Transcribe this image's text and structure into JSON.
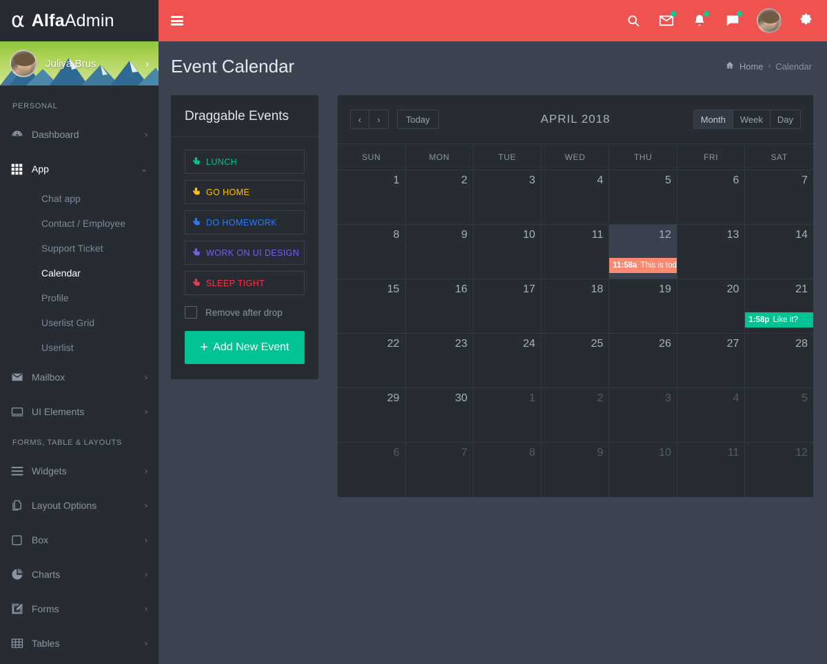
{
  "brand": {
    "glyph": "α",
    "bold": "Alfa",
    "light": "Admin"
  },
  "topbar": {
    "menu_icon": "hamburger-icon",
    "icons": [
      {
        "name": "search-icon",
        "badge": false
      },
      {
        "name": "mail-icon",
        "badge": true
      },
      {
        "name": "bell-icon",
        "badge": true
      },
      {
        "name": "chat-icon",
        "badge": true
      }
    ],
    "avatar_name": "user-avatar",
    "settings_icon": "gear-icon",
    "accent": "#ef5350"
  },
  "sidebar": {
    "profile": {
      "name": "Juliya Brus",
      "chevron": "›"
    },
    "sections": [
      {
        "title": "PERSONAL",
        "items": [
          {
            "label": "Dashboard",
            "icon": "dashboard-icon",
            "arrow": "›",
            "active": false,
            "children": []
          },
          {
            "label": "App",
            "icon": "grid-icon",
            "arrow": "⌄",
            "active": true,
            "children": [
              {
                "label": "Chat app",
                "active": false
              },
              {
                "label": "Contact / Employee",
                "active": false
              },
              {
                "label": "Support Ticket",
                "active": false
              },
              {
                "label": "Calendar",
                "active": true
              },
              {
                "label": "Profile",
                "active": false
              },
              {
                "label": "Userlist Grid",
                "active": false
              },
              {
                "label": "Userlist",
                "active": false
              }
            ]
          },
          {
            "label": "Mailbox",
            "icon": "envelope-icon",
            "arrow": "›",
            "active": false,
            "children": []
          },
          {
            "label": "UI Elements",
            "icon": "monitor-icon",
            "arrow": "›",
            "active": false,
            "children": []
          }
        ]
      },
      {
        "title": "FORMS, TABLE & LAYOUTS",
        "items": [
          {
            "label": "Widgets",
            "icon": "list-icon",
            "arrow": "›",
            "active": false,
            "children": []
          },
          {
            "label": "Layout Options",
            "icon": "copy-icon",
            "arrow": "›",
            "active": false,
            "children": []
          },
          {
            "label": "Box",
            "icon": "square-icon",
            "arrow": "›",
            "active": false,
            "children": []
          },
          {
            "label": "Charts",
            "icon": "pie-chart-icon",
            "arrow": "›",
            "active": false,
            "children": []
          },
          {
            "label": "Forms",
            "icon": "edit-icon",
            "arrow": "›",
            "active": false,
            "children": []
          },
          {
            "label": "Tables",
            "icon": "table-icon",
            "arrow": "›",
            "active": false,
            "children": []
          }
        ]
      }
    ]
  },
  "page": {
    "title": "Event Calendar",
    "breadcrumb": {
      "home_icon": "home-icon",
      "home": "Home",
      "sep": "›",
      "current": "Calendar"
    }
  },
  "draggable": {
    "title": "Draggable Events",
    "events": [
      {
        "label": "LUNCH",
        "color": "#00c292",
        "icon": "hand-pointer-icon"
      },
      {
        "label": "GO HOME",
        "color": "#fec107",
        "icon": "hand-pointer-icon"
      },
      {
        "label": "DO HOMEWORK",
        "color": "#2979ff",
        "icon": "hand-pointer-icon"
      },
      {
        "label": "WORK ON UI DESIGN",
        "color": "#7460ee",
        "icon": "hand-pointer-icon"
      },
      {
        "label": "SLEEP TIGHT",
        "color": "#f5354c",
        "icon": "hand-pointer-icon"
      }
    ],
    "remove_after_drop": {
      "label": "Remove after drop",
      "checked": false
    },
    "add_button": {
      "plus": "+",
      "label": "Add New Event"
    }
  },
  "calendar": {
    "toolbar": {
      "prev": "‹",
      "next": "›",
      "today": "Today",
      "title": "APRIL 2018",
      "views": [
        {
          "label": "Month",
          "active": true
        },
        {
          "label": "Week",
          "active": false
        },
        {
          "label": "Day",
          "active": false
        }
      ]
    },
    "day_headers": [
      "SUN",
      "MON",
      "TUE",
      "WED",
      "THU",
      "FRI",
      "SAT"
    ],
    "weeks": [
      [
        {
          "num": "1",
          "other": false,
          "today": false,
          "event": null
        },
        {
          "num": "2",
          "other": false,
          "today": false,
          "event": null
        },
        {
          "num": "3",
          "other": false,
          "today": false,
          "event": null
        },
        {
          "num": "4",
          "other": false,
          "today": false,
          "event": null
        },
        {
          "num": "5",
          "other": false,
          "today": false,
          "event": null
        },
        {
          "num": "6",
          "other": false,
          "today": false,
          "event": null
        },
        {
          "num": "7",
          "other": false,
          "today": false,
          "event": null
        }
      ],
      [
        {
          "num": "8",
          "other": false,
          "today": false,
          "event": null
        },
        {
          "num": "9",
          "other": false,
          "today": false,
          "event": null
        },
        {
          "num": "10",
          "other": false,
          "today": false,
          "event": null
        },
        {
          "num": "11",
          "other": false,
          "today": false,
          "event": null
        },
        {
          "num": "12",
          "other": false,
          "today": true,
          "event": {
            "time": "11:58a",
            "title": "This is today",
            "color": "#fa8a72"
          }
        },
        {
          "num": "13",
          "other": false,
          "today": false,
          "event": null
        },
        {
          "num": "14",
          "other": false,
          "today": false,
          "event": null
        }
      ],
      [
        {
          "num": "15",
          "other": false,
          "today": false,
          "event": null
        },
        {
          "num": "16",
          "other": false,
          "today": false,
          "event": null
        },
        {
          "num": "17",
          "other": false,
          "today": false,
          "event": null
        },
        {
          "num": "18",
          "other": false,
          "today": false,
          "event": null
        },
        {
          "num": "19",
          "other": false,
          "today": false,
          "event": null
        },
        {
          "num": "20",
          "other": false,
          "today": false,
          "event": null
        },
        {
          "num": "21",
          "other": false,
          "today": false,
          "event": {
            "time": "1:58p",
            "title": "Like it?",
            "color": "#00c292"
          }
        }
      ],
      [
        {
          "num": "22",
          "other": false,
          "today": false,
          "event": null
        },
        {
          "num": "23",
          "other": false,
          "today": false,
          "event": null
        },
        {
          "num": "24",
          "other": false,
          "today": false,
          "event": null
        },
        {
          "num": "25",
          "other": false,
          "today": false,
          "event": null
        },
        {
          "num": "26",
          "other": false,
          "today": false,
          "event": null
        },
        {
          "num": "27",
          "other": false,
          "today": false,
          "event": null
        },
        {
          "num": "28",
          "other": false,
          "today": false,
          "event": null
        }
      ],
      [
        {
          "num": "29",
          "other": false,
          "today": false,
          "event": null
        },
        {
          "num": "30",
          "other": false,
          "today": false,
          "event": null
        },
        {
          "num": "1",
          "other": true,
          "today": false,
          "event": null
        },
        {
          "num": "2",
          "other": true,
          "today": false,
          "event": null
        },
        {
          "num": "3",
          "other": true,
          "today": false,
          "event": null
        },
        {
          "num": "4",
          "other": true,
          "today": false,
          "event": null
        },
        {
          "num": "5",
          "other": true,
          "today": false,
          "event": null
        }
      ],
      [
        {
          "num": "6",
          "other": true,
          "today": false,
          "event": null
        },
        {
          "num": "7",
          "other": true,
          "today": false,
          "event": null
        },
        {
          "num": "8",
          "other": true,
          "today": false,
          "event": null
        },
        {
          "num": "9",
          "other": true,
          "today": false,
          "event": null
        },
        {
          "num": "10",
          "other": true,
          "today": false,
          "event": null
        },
        {
          "num": "11",
          "other": true,
          "today": false,
          "event": null
        },
        {
          "num": "12",
          "other": true,
          "today": false,
          "event": null
        }
      ]
    ]
  }
}
